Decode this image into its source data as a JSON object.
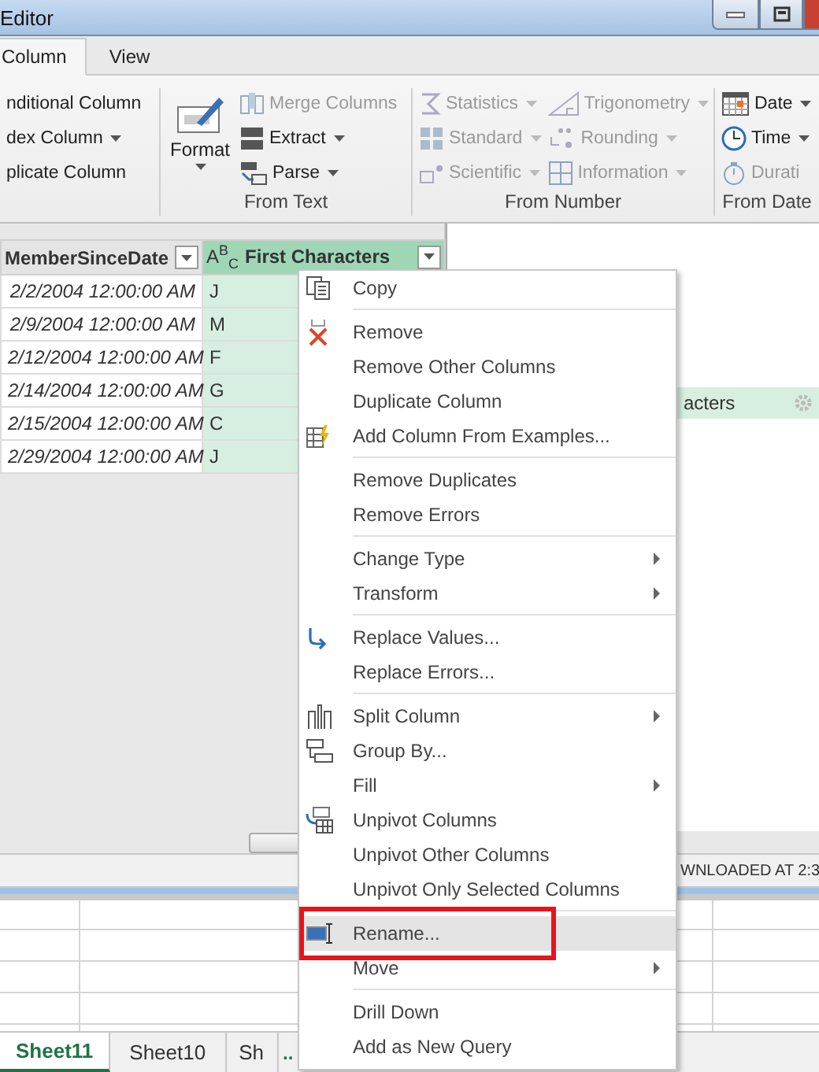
{
  "window": {
    "title": "Editor"
  },
  "tabs": [
    {
      "label": "Column",
      "selected": true
    },
    {
      "label": "View",
      "selected": false
    }
  ],
  "ribbon": {
    "groups": [
      {
        "columns": [
          [
            {
              "label": "nditional Column",
              "disabled": false,
              "dropdown": false
            },
            {
              "label": "dex Column",
              "disabled": false,
              "dropdown": true
            },
            {
              "label": "plicate Column",
              "disabled": false,
              "dropdown": false
            }
          ]
        ]
      },
      {
        "label": "From Text",
        "big": {
          "label": "Format",
          "dropdown": true
        },
        "columns": [
          [
            {
              "label": "Merge Columns",
              "disabled": true,
              "dropdown": false
            },
            {
              "label": "Extract",
              "disabled": false,
              "dropdown": true
            },
            {
              "label": "Parse",
              "disabled": false,
              "dropdown": true
            }
          ]
        ]
      },
      {
        "label": "From Number",
        "columns": [
          [
            {
              "label": "Statistics",
              "disabled": true,
              "dropdown": true
            },
            {
              "label": "Standard",
              "disabled": true,
              "dropdown": true
            },
            {
              "label": "Scientific",
              "disabled": true,
              "dropdown": true
            }
          ],
          [
            {
              "label": "Trigonometry",
              "disabled": true,
              "dropdown": true
            },
            {
              "label": "Rounding",
              "disabled": true,
              "dropdown": true
            },
            {
              "label": "Information",
              "disabled": true,
              "dropdown": true
            }
          ]
        ]
      },
      {
        "label": "From Date",
        "columns": [
          [
            {
              "label": "Date",
              "disabled": false,
              "dropdown": true
            },
            {
              "label": "Time",
              "disabled": false,
              "dropdown": true
            },
            {
              "label": "Durati",
              "disabled": true,
              "dropdown": false
            }
          ]
        ]
      }
    ]
  },
  "table": {
    "columns": [
      {
        "label": "MemberSinceDate",
        "selected": false
      },
      {
        "label": "First Characters",
        "type_label": "A$^{B}$$_{C}$",
        "selected": true
      }
    ],
    "rows": [
      [
        "2/2/2004 12:00:00 AM",
        "J"
      ],
      [
        "2/9/2004 12:00:00 AM",
        "M"
      ],
      [
        "2/12/2004 12:00:00 AM",
        "F"
      ],
      [
        "2/14/2004 12:00:00 AM",
        "G"
      ],
      [
        "2/15/2004 12:00:00 AM",
        "C"
      ],
      [
        "2/29/2004 12:00:00 AM",
        "J"
      ]
    ]
  },
  "applied_step": {
    "label": "acters",
    "selected": true
  },
  "status_bar": "WNLOADED AT 2:3",
  "sheets": [
    {
      "label": "Sheet11",
      "selected": true
    },
    {
      "label": "Sheet10",
      "selected": false
    },
    {
      "label": "Sh",
      "selected": false
    }
  ],
  "sheet_overflow": "..",
  "context_menu": {
    "sections": [
      [
        {
          "label": "Copy",
          "submenu": false,
          "selected": false
        }
      ],
      [
        {
          "label": "Remove",
          "submenu": false,
          "selected": false
        },
        {
          "label": "Remove Other Columns",
          "submenu": false,
          "selected": false
        },
        {
          "label": "Duplicate Column",
          "submenu": false,
          "selected": false
        },
        {
          "label": "Add Column From Examples...",
          "submenu": false,
          "selected": false
        }
      ],
      [
        {
          "label": "Remove Duplicates",
          "submenu": false,
          "selected": false
        },
        {
          "label": "Remove Errors",
          "submenu": false,
          "selected": false
        }
      ],
      [
        {
          "label": "Change Type",
          "submenu": true,
          "selected": false
        },
        {
          "label": "Transform",
          "submenu": true,
          "selected": false
        }
      ],
      [
        {
          "label": "Replace Values...",
          "submenu": false,
          "selected": false
        },
        {
          "label": "Replace Errors...",
          "submenu": false,
          "selected": false
        }
      ],
      [
        {
          "label": "Split Column",
          "submenu": true,
          "selected": false
        },
        {
          "label": "Group By...",
          "submenu": false,
          "selected": false
        },
        {
          "label": "Fill",
          "submenu": true,
          "selected": false
        },
        {
          "label": "Unpivot Columns",
          "submenu": false,
          "selected": false
        },
        {
          "label": "Unpivot Other Columns",
          "submenu": false,
          "selected": false
        },
        {
          "label": "Unpivot Only Selected Columns",
          "submenu": false,
          "selected": false
        }
      ],
      [
        {
          "label": "Rename...",
          "submenu": false,
          "selected": true,
          "annotated": true
        },
        {
          "label": "Move",
          "submenu": true,
          "selected": false
        }
      ],
      [
        {
          "label": "Drill Down",
          "submenu": false,
          "selected": false
        },
        {
          "label": "Add as New Query",
          "submenu": false,
          "selected": false
        }
      ]
    ]
  }
}
